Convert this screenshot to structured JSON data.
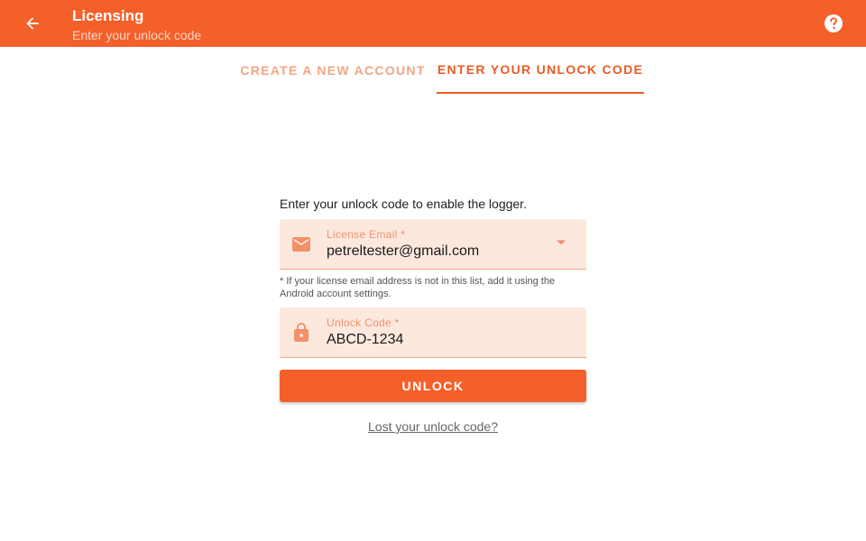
{
  "appbar": {
    "title": "Licensing",
    "subtitle": "Enter your unlock code",
    "back_icon": "arrow-left-icon",
    "help_icon": "help-circle-icon",
    "color": "#f4602a"
  },
  "tabs": [
    {
      "label": "CREATE A NEW ACCOUNT",
      "active": false
    },
    {
      "label": "ENTER YOUR UNLOCK CODE",
      "active": true
    }
  ],
  "form": {
    "intro": "Enter your unlock code to enable the logger.",
    "email_field": {
      "label": "License Email *",
      "value": "petreltester@gmail.com",
      "icon": "email-icon"
    },
    "email_hint": "* If your license email address is not in this list, add it using the Android account settings.",
    "code_field": {
      "label": "Unlock Code *",
      "value": "ABCD-1234",
      "icon": "lock-icon"
    },
    "unlock_button": "UNLOCK",
    "lost_link": "Lost your unlock code?"
  },
  "colors": {
    "accent": "#f4602a",
    "field_bg": "#fde8de",
    "label": "#f2906a"
  }
}
